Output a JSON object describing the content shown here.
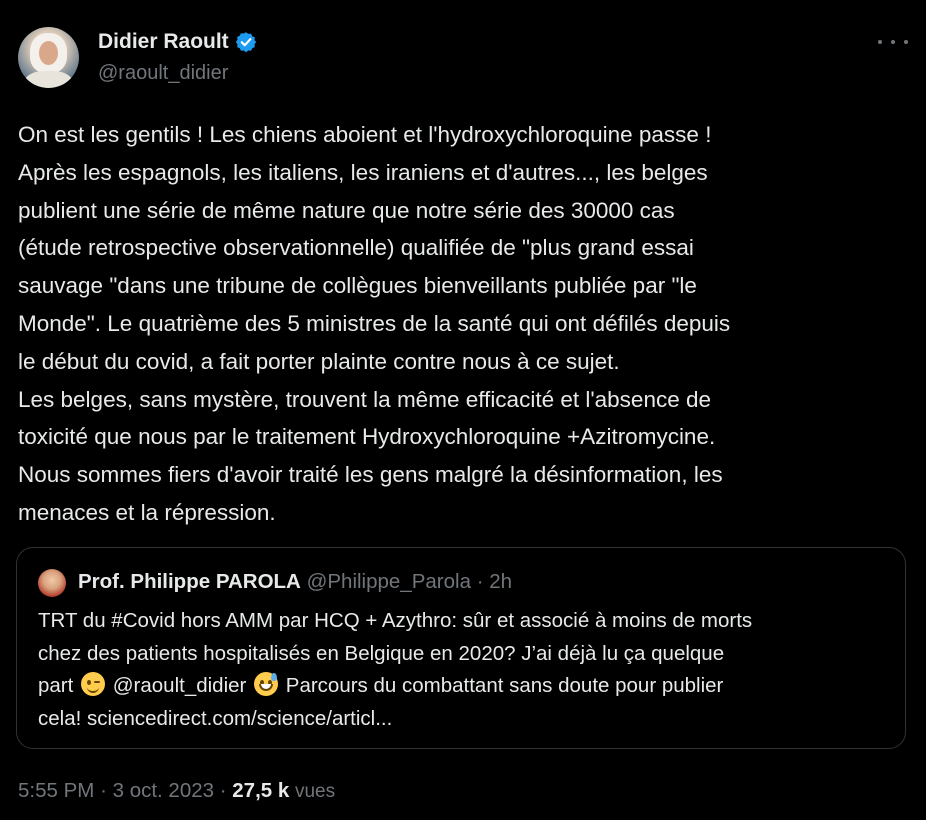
{
  "author": {
    "display_name": "Didier Raoult",
    "handle": "@raoult_didier",
    "verified": true,
    "avatar_icon": "profile-photo"
  },
  "menu_icon": "more-horizontal-icon",
  "post": {
    "lines": [
      "On est les gentils ! Les chiens aboient et l'hydroxychloroquine passe !",
      "Après les espagnols, les italiens, les iraniens et d'autres..., les belges",
      "publient une série de même nature que notre série des 30000 cas",
      "(étude retrospective observationnelle) qualifiée de \"plus grand essai",
      "sauvage \"dans une tribune de collègues bienveillants publiée par \"le",
      "Monde\". Le quatrième des 5 ministres de la santé qui ont défilés depuis",
      "le début du covid, a fait porter plainte contre nous à ce sujet.",
      "Les belges, sans mystère, trouvent la même efficacité et l'absence de",
      "toxicité que nous par le traitement Hydroxychloroquine +Azitromycine.",
      "Nous sommes fiers d'avoir traité les gens malgré la désinformation, les",
      "menaces et la répression."
    ]
  },
  "quote": {
    "display_name": "Prof. Philippe PAROLA",
    "handle": "@Philippe_Parola",
    "separator": "·",
    "time": "2h",
    "line1": "TRT du #Covid hors AMM par HCQ + Azythro: sûr et associé à moins de morts",
    "line2": "chez des patients hospitalisés en Belgique en 2020? J’ai déjà lu ça quelque",
    "line3_a": "part",
    "line3_b": "@raoult_didier",
    "line3_c": "Parcours du combattant sans doute pour publier",
    "line4": "cela!  sciencedirect.com/science/articl...",
    "emoji_1": "winking-face-emoji",
    "emoji_2": "grinning-sweat-emoji"
  },
  "meta": {
    "time": "5:55 PM",
    "date": "3 oct. 2023",
    "separator": "·",
    "views_count": "27,5 k",
    "views_label": "vues"
  },
  "colors": {
    "background": "#000000",
    "text": "#e7e9ea",
    "muted": "#71767b",
    "verified": "#1d9bf0",
    "border": "#2f3336"
  }
}
